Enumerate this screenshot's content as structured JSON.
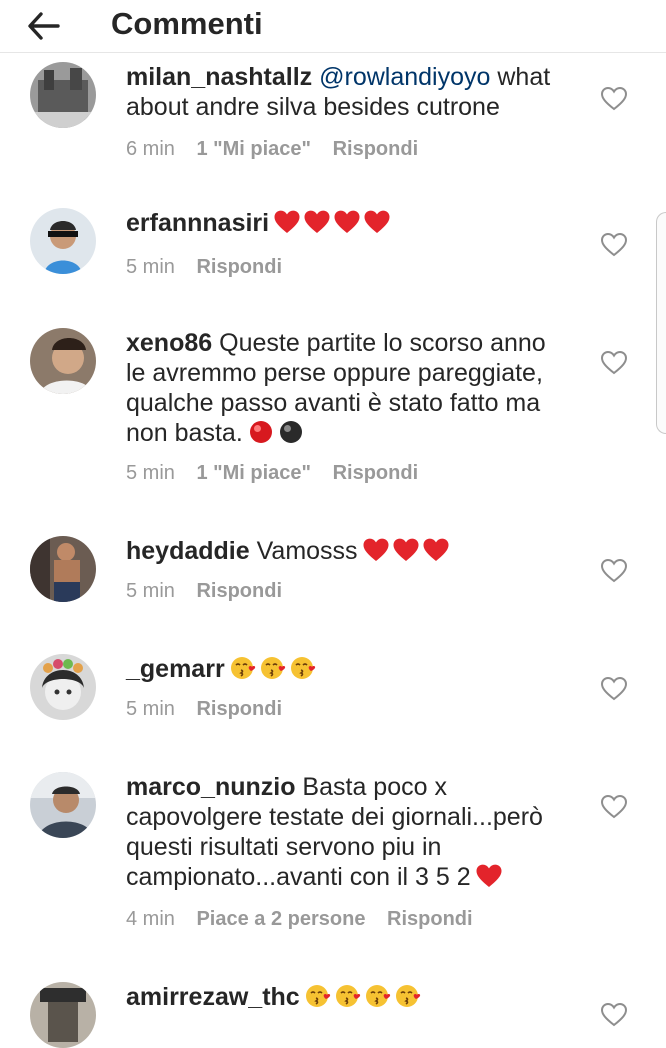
{
  "header": {
    "title": "Commenti",
    "back_icon": "arrow-left-icon"
  },
  "colors": {
    "text": "#262626",
    "muted": "#999999",
    "mention": "#003569",
    "heart_red": "#ed4956"
  },
  "comments": [
    {
      "username": "milan_nashtallz",
      "mention": "@rowlandiyoyo",
      "text": " what about andre silva besides cutrone",
      "emojis": [],
      "time": "6 min",
      "likes": "1 \"Mi piace\"",
      "reply": "Rispondi"
    },
    {
      "username": "erfannnasiri",
      "mention": "",
      "text": "",
      "emojis": [
        "red-heart",
        "red-heart",
        "red-heart",
        "red-heart"
      ],
      "time": "5 min",
      "likes": "",
      "reply": "Rispondi"
    },
    {
      "username": "xeno86",
      "mention": "",
      "text": " Queste partite lo scorso anno le avremmo perse oppure pareggiate, qualche passo avanti è stato fatto ma non basta.",
      "emojis": [
        "red-circle",
        "black-circle"
      ],
      "time": "5 min",
      "likes": "1 \"Mi piace\"",
      "reply": "Rispondi"
    },
    {
      "username": "heydaddie",
      "mention": "",
      "text": " Vamosss",
      "emojis": [
        "red-heart",
        "red-heart",
        "red-heart"
      ],
      "time": "5 min",
      "likes": "",
      "reply": "Rispondi"
    },
    {
      "username": "_gemarr",
      "mention": "",
      "text": "",
      "emojis": [
        "kissing-face",
        "kissing-face",
        "kissing-face"
      ],
      "time": "5 min",
      "likes": "",
      "reply": "Rispondi"
    },
    {
      "username": "marco_nunzio",
      "mention": "",
      "text": " Basta poco x capovolgere testate dei giornali...però questi risultati servono piu in campionato...avanti con il 3 5 2",
      "emojis": [
        "red-heart"
      ],
      "time": "4 min",
      "likes": "Piace a 2 persone",
      "reply": "Rispondi"
    },
    {
      "username": "amirrezaw_thc",
      "mention": "",
      "text": "",
      "emojis": [
        "kissing-face",
        "kissing-face",
        "kissing-face",
        "kissing-face"
      ],
      "time": "",
      "likes": "",
      "reply": ""
    }
  ]
}
